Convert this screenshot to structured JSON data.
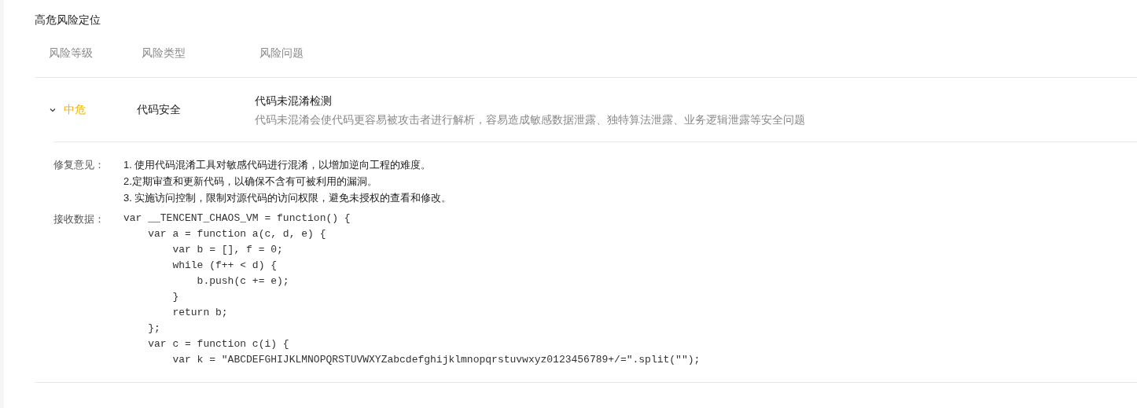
{
  "section_title": "高危风险定位",
  "table": {
    "columns": [
      "风险等级",
      "风险类型",
      "风险问题"
    ],
    "rows": [
      {
        "level": "中危",
        "color": "#f0b400",
        "expanded": true,
        "type": "代码安全",
        "problem_title": "代码未混淆检测",
        "problem_desc": "代码未混淆会使代码更容易被攻击者进行解析，容易造成敏感数据泄露、独特算法泄露、业务逻辑泄露等安全问题",
        "details": [
          {
            "kind": "text",
            "label": "修复意见：",
            "lines": [
              "1. 使用代码混淆工具对敏感代码进行混淆，以增加逆向工程的难度。",
              "2.定期审查和更新代码，以确保不含有可被利用的漏洞。",
              "3. 实施访问控制，限制对源代码的访问权限，避免未授权的查看和修改。"
            ]
          },
          {
            "kind": "code",
            "label": "接收数据：",
            "lines": [
              "var __TENCENT_CHAOS_VM = function() {",
              "    var a = function a(c, d, e) {",
              "        var b = [], f = 0;",
              "        while (f++ < d) {",
              "            b.push(c += e);",
              "        }",
              "        return b;",
              "    };",
              "    var c = function c(i) {",
              "        var k = \"ABCDEFGHIJKLMNOPQRSTUVWXYZabcdefghijklmnopqrstuvwxyz0123456789+/=\".split(\"\");"
            ]
          }
        ]
      }
    ]
  }
}
